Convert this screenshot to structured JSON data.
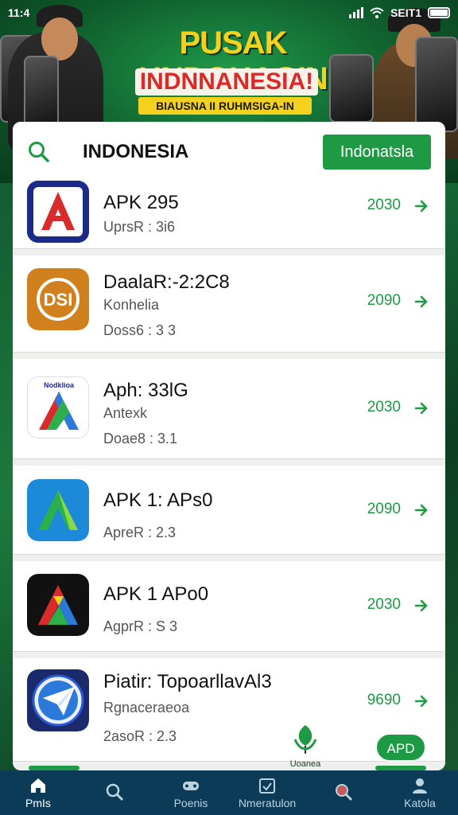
{
  "status_bar": {
    "time": "11:4",
    "carrier": "SEIT1"
  },
  "banner": {
    "title": "PUSAK UNDOHAGIN",
    "subtitle": "INDNNANESIA!",
    "tagline": "BIAUSNA II RUHMSIGA-IN"
  },
  "search": {
    "query": "INDONESIA",
    "button_label": "Indonatsla"
  },
  "apps": [
    {
      "name": "APK 295",
      "line2": "",
      "line3": "UprsR : 3i6",
      "size": "2030",
      "icon": "a-red-icon"
    },
    {
      "name": "DaalaR:-2:2C8",
      "line2": "Konhelia",
      "line3": "Doss6 : 3 3",
      "size": "2090",
      "icon": "dsi-orange-icon"
    },
    {
      "name": "Aph: 33lG",
      "line2": "Antexk",
      "line3": "Doae8 : 3.1",
      "size": "2030",
      "icon": "a-tricolor-icon"
    },
    {
      "name": "APK 1: APs0",
      "line2": "",
      "line3": "ApreR : 2.3",
      "size": "2090",
      "icon": "a-green-blue-icon"
    },
    {
      "name": "APK 1 APo0",
      "line2": "",
      "line3": "AgprR : S 3",
      "size": "2030",
      "icon": "a-dark-rainbow-icon"
    },
    {
      "name": "Piatir: TopoarllavAl3",
      "line2": "Rgnaceraeoa",
      "line3": "2asoR : 2.3",
      "size": "9690",
      "icon": "paper-plane-emblem-icon"
    }
  ],
  "floating": {
    "apk_label": "APD",
    "center_caption": "Uoanea"
  },
  "bottom_nav": [
    {
      "label": "PmIs",
      "icon": "home-icon",
      "active": true
    },
    {
      "label": "",
      "icon": "search-icon",
      "active": false
    },
    {
      "label": "Poenis",
      "icon": "gamepad-icon",
      "active": false
    },
    {
      "label": "Nmeratulon",
      "icon": "calendar-check-icon",
      "active": false
    },
    {
      "label": "",
      "icon": "magnifier-icon",
      "active": false
    },
    {
      "label": "Katola",
      "icon": "person-icon",
      "active": false
    }
  ],
  "colors": {
    "accent": "#1e9a44",
    "nav_bg": "#0c3b57",
    "banner_yellow": "#f4d11c",
    "banner_red": "#d92b2b"
  }
}
